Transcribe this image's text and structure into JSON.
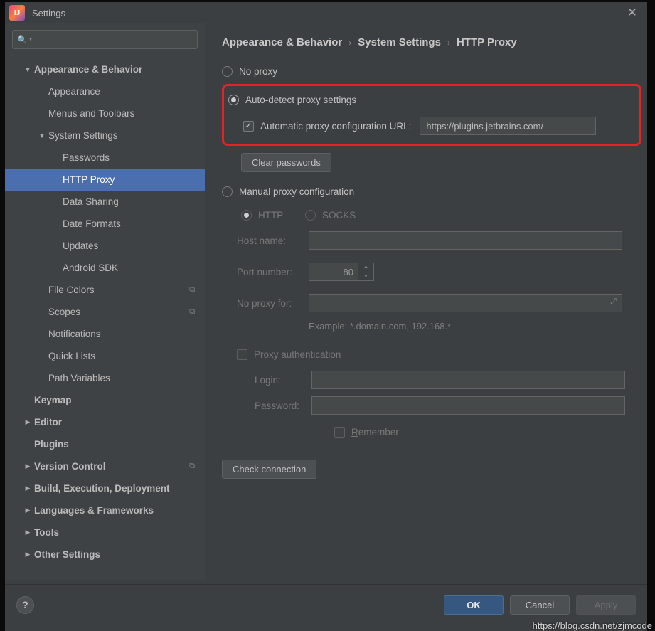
{
  "window": {
    "title": "Settings",
    "logo_text": "IJ"
  },
  "search": {
    "placeholder": ""
  },
  "sidebar": {
    "items": [
      {
        "name": "appearance-behavior",
        "label": "Appearance & Behavior",
        "bold": true,
        "expanded": true,
        "depth": 1,
        "hasKids": true
      },
      {
        "name": "appearance",
        "label": "Appearance",
        "depth": 2
      },
      {
        "name": "menus-toolbars",
        "label": "Menus and Toolbars",
        "depth": 2
      },
      {
        "name": "system-settings",
        "label": "System Settings",
        "expanded": true,
        "depth": 2,
        "hasKids": true
      },
      {
        "name": "passwords",
        "label": "Passwords",
        "depth": 3
      },
      {
        "name": "http-proxy",
        "label": "HTTP Proxy",
        "depth": 3,
        "selected": true
      },
      {
        "name": "data-sharing",
        "label": "Data Sharing",
        "depth": 3
      },
      {
        "name": "date-formats",
        "label": "Date Formats",
        "depth": 3
      },
      {
        "name": "updates",
        "label": "Updates",
        "depth": 3
      },
      {
        "name": "android-sdk",
        "label": "Android SDK",
        "depth": 3
      },
      {
        "name": "file-colors",
        "label": "File Colors",
        "depth": 2,
        "badge": "⧉"
      },
      {
        "name": "scopes",
        "label": "Scopes",
        "depth": 2,
        "badge": "⧉"
      },
      {
        "name": "notifications",
        "label": "Notifications",
        "depth": 2
      },
      {
        "name": "quick-lists",
        "label": "Quick Lists",
        "depth": 2
      },
      {
        "name": "path-variables",
        "label": "Path Variables",
        "depth": 2
      },
      {
        "name": "keymap",
        "label": "Keymap",
        "bold": true,
        "depth": 1
      },
      {
        "name": "editor",
        "label": "Editor",
        "bold": true,
        "depth": 1,
        "hasKids": true
      },
      {
        "name": "plugins",
        "label": "Plugins",
        "bold": true,
        "depth": 1
      },
      {
        "name": "version-control",
        "label": "Version Control",
        "bold": true,
        "depth": 1,
        "hasKids": true,
        "badge": "⧉"
      },
      {
        "name": "build-exec",
        "label": "Build, Execution, Deployment",
        "bold": true,
        "depth": 1,
        "hasKids": true
      },
      {
        "name": "lang-frameworks",
        "label": "Languages & Frameworks",
        "bold": true,
        "depth": 1,
        "hasKids": true
      },
      {
        "name": "tools",
        "label": "Tools",
        "bold": true,
        "depth": 1,
        "hasKids": true
      },
      {
        "name": "other-settings",
        "label": "Other Settings",
        "bold": true,
        "depth": 1,
        "hasKids": true
      }
    ]
  },
  "breadcrumbs": [
    "Appearance & Behavior",
    "System Settings",
    "HTTP Proxy"
  ],
  "proxy": {
    "no_proxy_label": "No proxy",
    "auto_detect_label": "Auto-detect proxy settings",
    "auto_url_label": "Automatic proxy configuration URL:",
    "auto_url_value": "https://plugins.jetbrains.com/",
    "clear_passwords": "Clear passwords",
    "manual_label": "Manual proxy configuration",
    "http_label": "HTTP",
    "socks_label": "SOCKS",
    "host_label": "Host name:",
    "port_label": "Port number:",
    "port_value": "80",
    "noproxy_label": "No proxy for:",
    "example": "Example: *.domain.com, 192.168.*",
    "auth_label": "Proxy authentication",
    "login_label": "Login:",
    "password_label": "Password:",
    "remember_label": "Remember",
    "check_conn": "Check connection"
  },
  "footer": {
    "ok": "OK",
    "cancel": "Cancel",
    "apply": "Apply"
  },
  "watermark": "https://blog.csdn.net/zjmcode"
}
